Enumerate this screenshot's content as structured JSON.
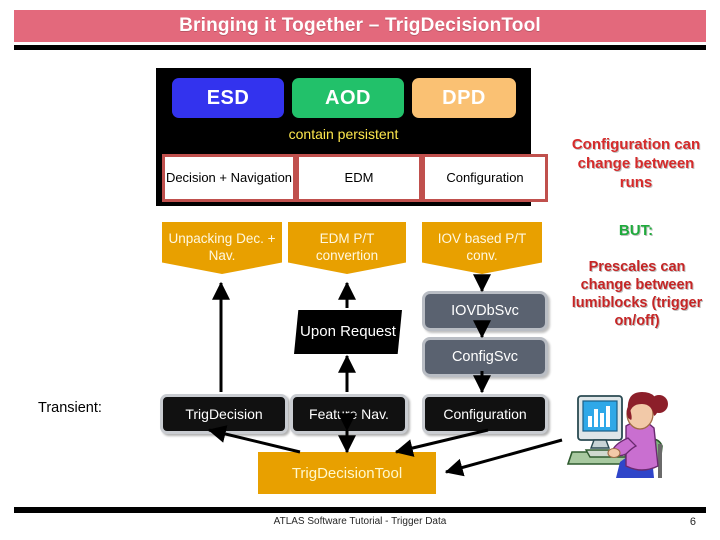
{
  "slide": {
    "title": "Bringing it Together – TrigDecisionTool",
    "footer_text": "ATLAS Software Tutorial - Trigger Data",
    "page_number": "6"
  },
  "persistent_panel": {
    "formats": [
      {
        "label": "ESD",
        "color": "#3333ee"
      },
      {
        "label": "AOD",
        "color": "#22c16a"
      },
      {
        "label": "DPD",
        "color": "#fac173"
      }
    ],
    "caption": "contain persistent",
    "contents": [
      {
        "label": "Decision + Navigation"
      },
      {
        "label": "EDM"
      },
      {
        "label": "Configuration"
      }
    ]
  },
  "converters": [
    {
      "label": "Unpacking Dec. + Nav."
    },
    {
      "label": "EDM P/T convertion"
    },
    {
      "label": "IOV based P/T conv."
    }
  ],
  "upon_request": {
    "label": "Upon Request"
  },
  "services": [
    {
      "label": "IOVDbSvc"
    },
    {
      "label": "ConfigSvc"
    }
  ],
  "transient": {
    "label": "Transient:",
    "boxes": [
      {
        "label": "TrigDecision"
      },
      {
        "label": "Feature Nav."
      },
      {
        "label": "Configuration"
      }
    ]
  },
  "tool": {
    "label": "TrigDecisionTool"
  },
  "notes": {
    "configuration": "Configuration can change between runs",
    "but": "BUT:",
    "prescales": "Prescales can change between lumiblocks (trigger on/off)"
  },
  "colors": {
    "title_bar": "#e3697c",
    "orange": "#e8a000",
    "gray_service": "#5a6270",
    "note_red": "#d62b2b",
    "note_green": "#1faa3c",
    "caption_yellow": "#ffe84d"
  }
}
